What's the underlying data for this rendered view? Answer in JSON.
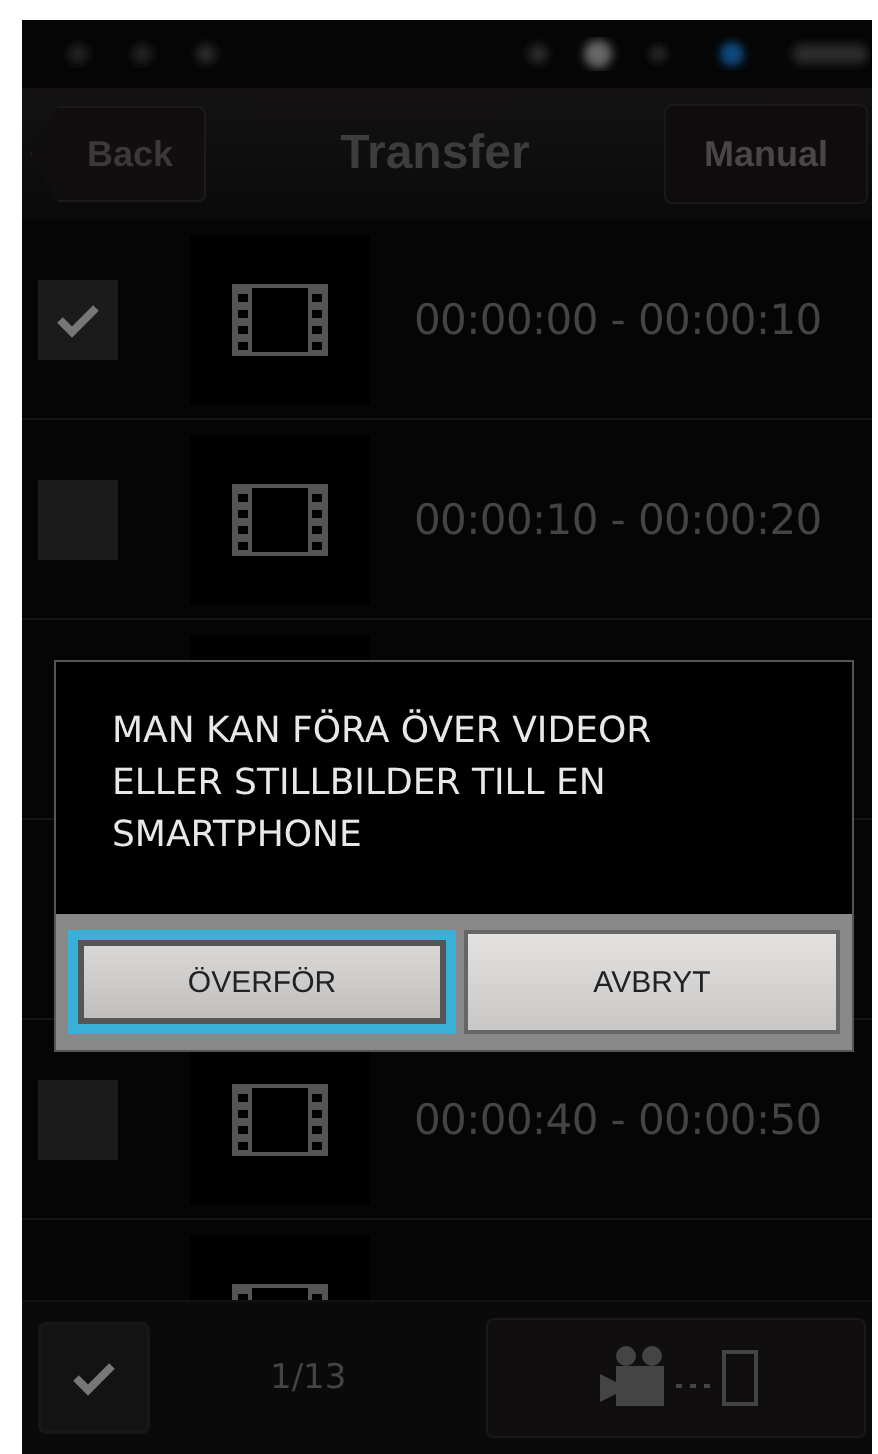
{
  "header": {
    "back": "Back",
    "title": "Transfer",
    "manual": "Manual"
  },
  "clips": [
    {
      "kind": "clip",
      "checked": true,
      "time": "00:00:00 - 00:00:10"
    },
    {
      "kind": "clip",
      "checked": false,
      "time": "00:00:10 - 00:00:20"
    },
    {
      "kind": "covered"
    },
    {
      "kind": "covered"
    },
    {
      "kind": "clip",
      "checked": false,
      "time": "00:00:40 - 00:00:50"
    },
    {
      "kind": "covered"
    }
  ],
  "dialog": {
    "message": "MAN KAN FÖRA ÖVER VIDEOR ELLER STILLBILDER TILL EN SMARTPHONE",
    "buttons": [
      {
        "label": "ÖVERFÖR",
        "selected": true
      },
      {
        "label": "AVBRYT",
        "selected": false
      }
    ]
  },
  "bottom_bar": {
    "select_all": true,
    "count": "1/13"
  }
}
